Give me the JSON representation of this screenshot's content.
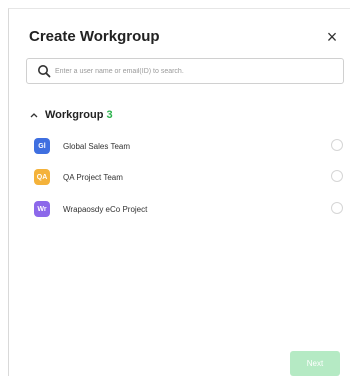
{
  "dialog": {
    "title": "Create Workgroup",
    "close_symbol": "×"
  },
  "search": {
    "placeholder": "Enter a user name or email(ID) to search.",
    "value": "",
    "icon": "search-icon"
  },
  "group": {
    "name": "Workgroup",
    "count": "3",
    "expanded": true,
    "count_color": "#2bb24c"
  },
  "items": [
    {
      "initials": "Gl",
      "label": "Global Sales Team",
      "color": "#3f6fe0",
      "selected": false
    },
    {
      "initials": "QA",
      "label": "QA Project Team",
      "color": "#f4b23a",
      "selected": false
    },
    {
      "initials": "Wr",
      "label": "Wrapaosdy eCo Project",
      "color": "#8c68ea",
      "selected": false
    }
  ],
  "footer": {
    "next_label": "Next",
    "next_color": "#b5eac4",
    "next_enabled": false
  }
}
